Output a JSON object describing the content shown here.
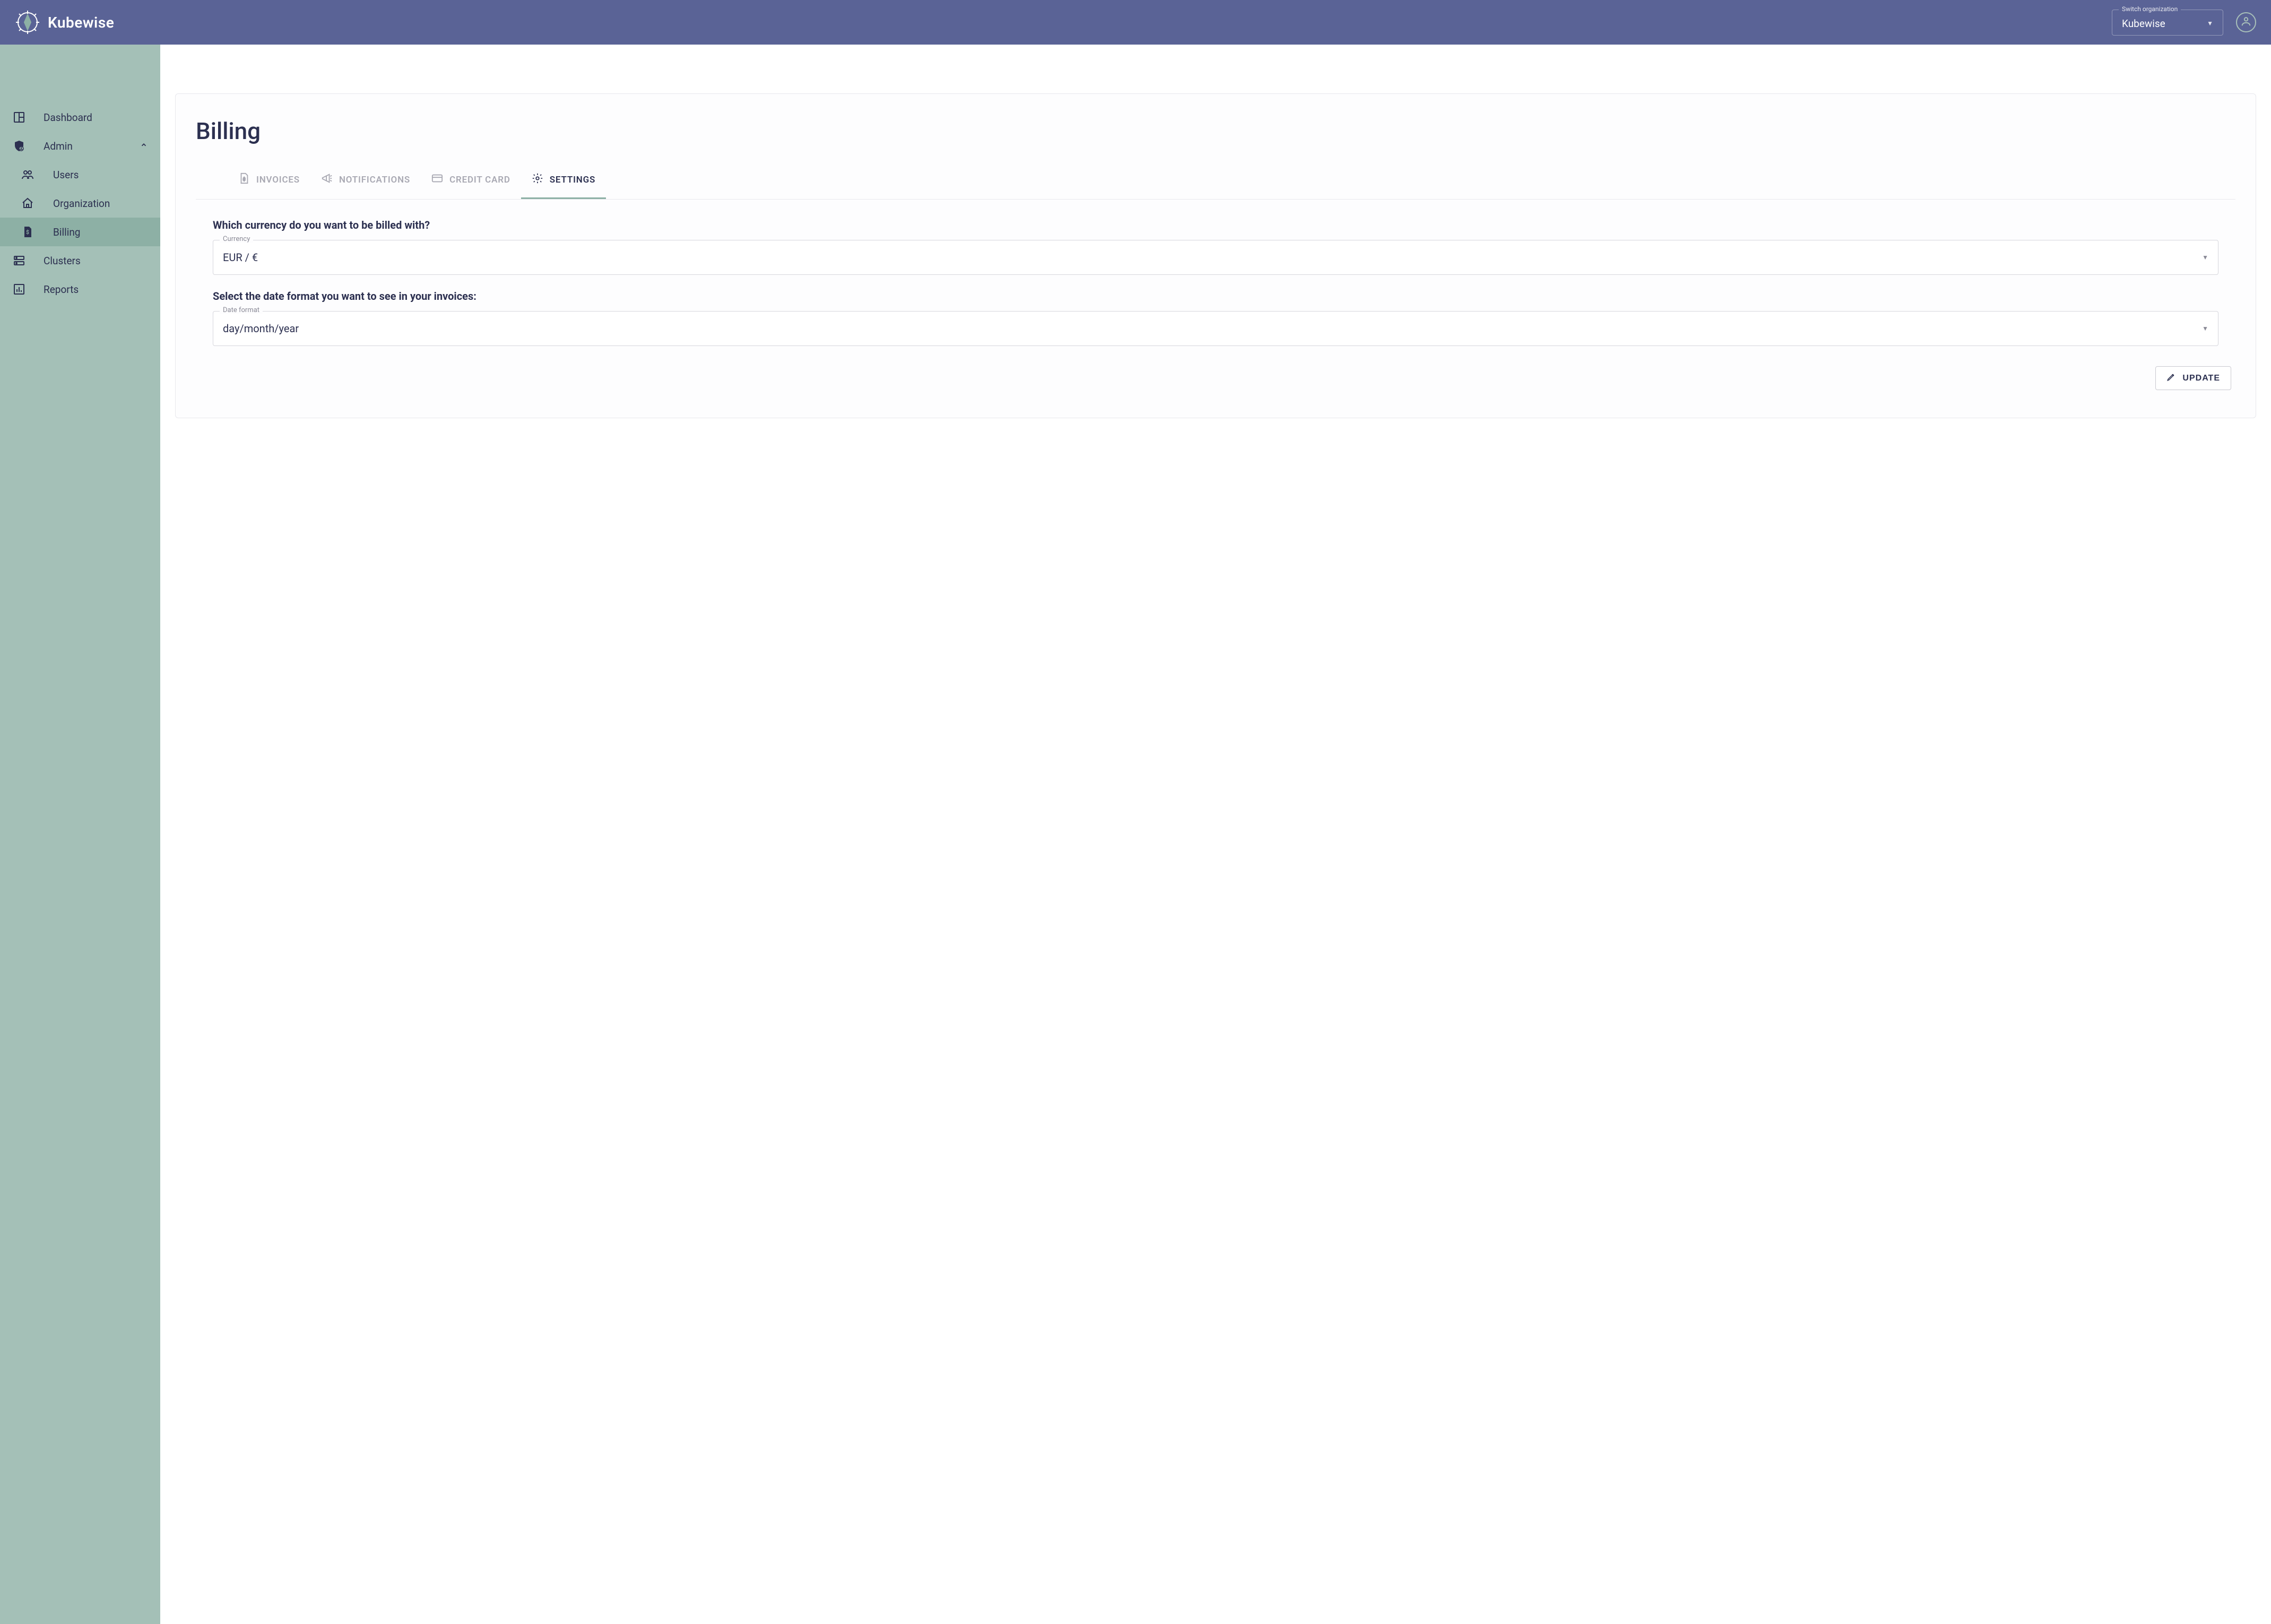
{
  "brand": {
    "name": "Kubewise"
  },
  "header": {
    "org_switcher": {
      "label": "Switch organization",
      "value": "Kubewise"
    }
  },
  "sidebar": {
    "items": [
      {
        "label": "Dashboard"
      },
      {
        "label": "Admin"
      },
      {
        "label": "Users"
      },
      {
        "label": "Organization"
      },
      {
        "label": "Billing"
      },
      {
        "label": "Clusters"
      },
      {
        "label": "Reports"
      }
    ]
  },
  "page": {
    "title": "Billing"
  },
  "tabs": {
    "invoices": "INVOICES",
    "notifications": "NOTIFICATIONS",
    "credit_card": "CREDIT CARD",
    "settings": "SETTINGS"
  },
  "form": {
    "currency_question": "Which currency do you want to be billed with?",
    "currency_label": "Currency",
    "currency_value": "EUR / €",
    "dateformat_question": "Select the date format you want to see in your invoices:",
    "dateformat_label": "Date format",
    "dateformat_value": "day/month/year",
    "update_button": "UPDATE"
  }
}
